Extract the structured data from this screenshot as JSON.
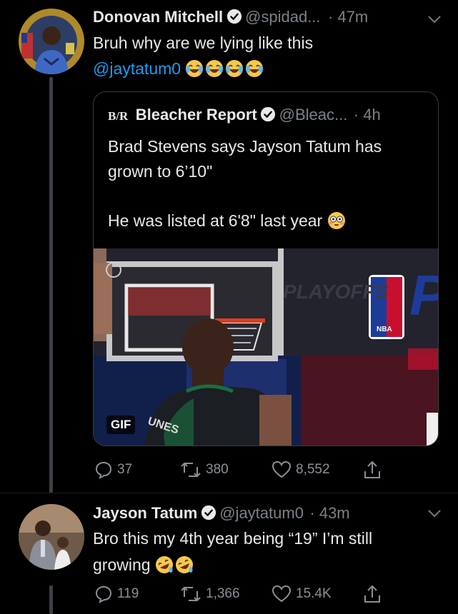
{
  "tweets": [
    {
      "name": "Donovan Mitchell",
      "handle": "@spidad...",
      "time": "· 47m",
      "text": "Bruh why are we lying like this",
      "mention": "@jaytatum0",
      "emoji": [
        "laughing-tears",
        "laughing-tears",
        "laughing-tears",
        "laughing-tears"
      ],
      "quote": {
        "logo": "B/R",
        "name": "Bleacher Report",
        "handle": "@Bleac...",
        "time": "· 4h",
        "line1": "Brad Stevens says Jayson Tatum has",
        "line2": "grown to 6’10\"",
        "line3": "He was listed at 6'8\" last year",
        "gif_badge": "GIF",
        "jersey_text": "UNES",
        "backdrop_text": "PLAYOFFS",
        "court_letter": "P",
        "nba_label": "NBA"
      },
      "replies": "37",
      "retweets": "380",
      "likes": "8,552"
    },
    {
      "name": "Jayson Tatum",
      "handle": "@jaytatum0",
      "time": "· 43m",
      "text_line1": "Bro this my 4th year being “19” I’m still",
      "text_line2": "growing",
      "emoji": [
        "rofl",
        "rofl"
      ],
      "replies": "119",
      "retweets": "1,366",
      "likes": "15.4K"
    }
  ],
  "colors": {
    "accent": "#1d9bf0",
    "background": "#000000",
    "muted": "#7b8188"
  }
}
